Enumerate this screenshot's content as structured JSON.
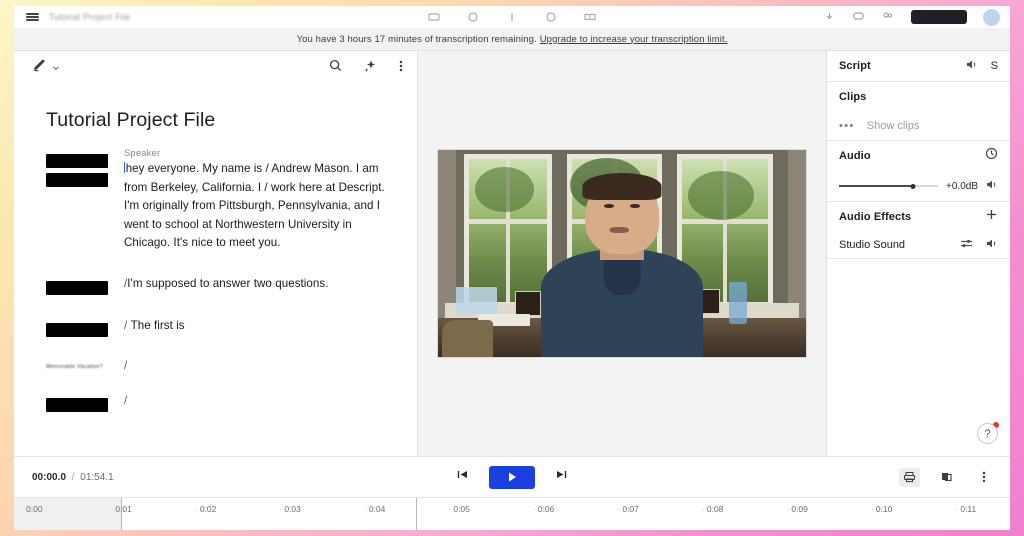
{
  "window": {
    "project_title_blurred": "Tutorial Project File",
    "share_button_label": "",
    "top_icons": [
      "folder-icon",
      "clock-icon",
      "cut-icon",
      "comment-icon",
      "layout-icon"
    ],
    "top_right_icons": [
      "download-icon",
      "chat-icon",
      "people-icon"
    ]
  },
  "banner": {
    "message": "You have 3 hours 17 minutes of transcription remaining.",
    "link": "Upgrade to increase your transcription limit."
  },
  "script": {
    "toolbar": {
      "edit_mode": "pen-icon",
      "edit_chevron": "chevron-down-icon",
      "search": "search-icon",
      "ai": "sparkle-icon",
      "more": "kebab-menu-icon"
    },
    "document_title": "Tutorial Project File",
    "paragraphs": [
      {
        "speaker": "Speaker",
        "gutter": "redacted-double",
        "text": "hey everyone. My name is / Andrew Mason. I am from Berkeley, California. I / work here at Descript. I'm originally from Pittsburgh, Pennsylvania, and I went to school at Northwestern University in Chicago. It's nice to meet you.",
        "has_caret": true
      },
      {
        "speaker": "",
        "gutter": "redacted",
        "text": "I'm supposed to answer two questions.",
        "has_caret": false
      },
      {
        "speaker": "",
        "gutter": "redacted",
        "text": "The first is",
        "has_caret": false
      },
      {
        "speaker": "",
        "gutter": "blurred-label",
        "blurred_label": "Memorable Vacation?",
        "text": "",
        "has_caret": false
      },
      {
        "speaker": "",
        "gutter": "redacted",
        "text": "",
        "has_caret": false
      }
    ],
    "slash_mark": "/"
  },
  "preview": {
    "description": "Video preview of a man in a dark blue shirt seated at a desk in front of three bright windows with green foliage outside."
  },
  "inspector": {
    "sections": [
      {
        "title": "Script",
        "icons": [
          "volume-icon"
        ],
        "letter": "S"
      },
      {
        "title": "Clips",
        "sub_dots": "•••",
        "sub_label": "Show clips"
      },
      {
        "title": "Audio",
        "icons": [
          "history-icon"
        ],
        "gain_value": "+0.0dB",
        "gain_percent": 75,
        "volume_icon": "volume-icon"
      },
      {
        "title": "Audio Effects",
        "icons": [
          "plus-icon"
        ],
        "effects": [
          {
            "name": "Studio Sound",
            "icons": [
              "sliders-icon",
              "volume-icon"
            ]
          }
        ]
      }
    ],
    "help_label": "?"
  },
  "transport": {
    "current_time": "00:00.0",
    "separator": "/",
    "duration": "01:54.1",
    "buttons": {
      "skip_back": "skip-back-icon",
      "play": "play-icon",
      "skip_forward": "skip-forward-icon"
    },
    "right_icons": [
      "printer-icon",
      "layers-icon",
      "kebab-menu-icon"
    ]
  },
  "timeline": {
    "ticks": [
      "0:00",
      "0:01",
      "0:02",
      "0:03",
      "0:04",
      "0:05",
      "0:06",
      "0:07",
      "0:08",
      "0:09",
      "0:10",
      "0:11"
    ]
  },
  "colors": {
    "accent_blue": "#1a41e0",
    "caret_blue": "#3b5bdb",
    "notification_red": "#e8342b",
    "banner_bg": "#f2f2f2"
  }
}
